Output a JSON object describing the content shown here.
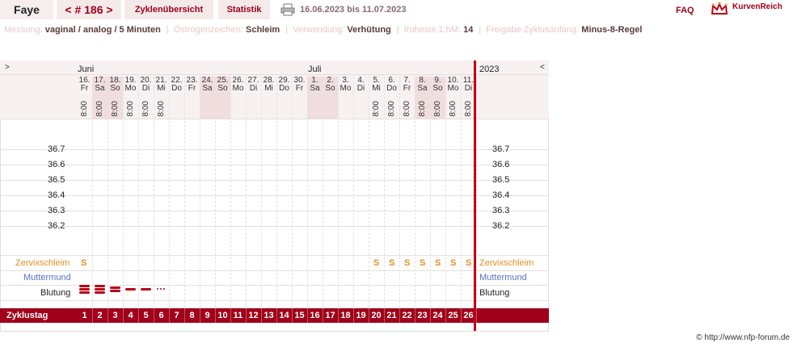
{
  "topbar": {
    "name": "Faye",
    "cycle": "< # 186 >",
    "tab_cycles": "Zyklenübersicht",
    "tab_stats": "Statistik",
    "date_range": "16.06.2023 bis 11.07.2023",
    "faq": "FAQ",
    "brand": "KurvenReich"
  },
  "info": {
    "messung_k": "Messung:",
    "messung_v": "vaginal / analog / 5 Minuten",
    "oestrogen_k": "Östrogenzeichen:",
    "oestrogen_v": "Schleim",
    "verwendung_k": "Verwendung:",
    "verwendung_v": "Verhütung",
    "hm_k": "früheste 1.hM:",
    "hm_v": "14",
    "freigabe_k": "Freigabe Zyklusanfang:",
    "freigabe_v": "Minus-8-Regel"
  },
  "chart": {
    "nav_left": ">",
    "nav_right": "<",
    "month_june": "Juni",
    "month_july": "Juli",
    "year": "2023",
    "temps": [
      "36.7",
      "36.6",
      "36.5",
      "36.4",
      "36.3",
      "36.2"
    ],
    "zervix_label": "Zervixschleim",
    "mutter_label": "Muttermund",
    "blut_label": "Blutung",
    "zyklustag_label": "Zyklustag",
    "days": [
      {
        "d": "16.",
        "w": "Fr",
        "t": "8:00",
        "s": "",
        "we": false
      },
      {
        "d": "17.",
        "w": "Sa",
        "t": "8:00",
        "s": "",
        "we": true
      },
      {
        "d": "18.",
        "w": "So",
        "t": "8:00",
        "s": "",
        "we": true
      },
      {
        "d": "19.",
        "w": "Mo",
        "t": "8:00",
        "s": "",
        "we": false
      },
      {
        "d": "20.",
        "w": "Di",
        "t": "8:00",
        "s": "",
        "we": false
      },
      {
        "d": "21.",
        "w": "Mi",
        "t": "8:00",
        "s": "",
        "we": false
      },
      {
        "d": "22.",
        "w": "Do",
        "t": "",
        "s": "",
        "we": false
      },
      {
        "d": "23.",
        "w": "Fr",
        "t": "",
        "s": "",
        "we": false
      },
      {
        "d": "24.",
        "w": "Sa",
        "t": "",
        "s": "",
        "we": true
      },
      {
        "d": "25.",
        "w": "So",
        "t": "",
        "s": "",
        "we": true
      },
      {
        "d": "26.",
        "w": "Mo",
        "t": "",
        "s": "",
        "we": false
      },
      {
        "d": "27.",
        "w": "Di",
        "t": "",
        "s": "",
        "we": false
      },
      {
        "d": "28.",
        "w": "Mi",
        "t": "",
        "s": "",
        "we": false
      },
      {
        "d": "29.",
        "w": "Do",
        "t": "",
        "s": "",
        "we": false
      },
      {
        "d": "30.",
        "w": "Fr",
        "t": "",
        "s": "",
        "we": false
      },
      {
        "d": "1.",
        "w": "Sa",
        "t": "",
        "s": "",
        "we": true
      },
      {
        "d": "2.",
        "w": "So",
        "t": "",
        "s": "",
        "we": true
      },
      {
        "d": "3.",
        "w": "Mo",
        "t": "",
        "s": "",
        "we": false
      },
      {
        "d": "4.",
        "w": "Di",
        "t": "",
        "s": "",
        "we": false
      },
      {
        "d": "5.",
        "w": "Mi",
        "t": "8:00",
        "s": "S",
        "we": false
      },
      {
        "d": "6.",
        "w": "Do",
        "t": "8:00",
        "s": "S",
        "we": false
      },
      {
        "d": "7.",
        "w": "Fr",
        "t": "8:00",
        "s": "S",
        "we": false
      },
      {
        "d": "8.",
        "w": "Sa",
        "t": "8:00",
        "s": "S",
        "we": true
      },
      {
        "d": "9.",
        "w": "So",
        "t": "8:00",
        "s": "S",
        "we": true
      },
      {
        "d": "10.",
        "w": "Mo",
        "t": "8:00",
        "s": "S",
        "we": false
      },
      {
        "d": "11.",
        "w": "Di",
        "t": "8:00",
        "s": "S",
        "we": false
      }
    ],
    "day1_zervix": "S",
    "bleeding_levels": [
      3,
      3,
      2,
      1,
      1,
      0.5
    ],
    "cycle_days": [
      "1",
      "2",
      "3",
      "4",
      "5",
      "6",
      "7",
      "8",
      "9",
      "10",
      "11",
      "12",
      "13",
      "14",
      "15",
      "16",
      "17",
      "18",
      "19",
      "20",
      "21",
      "22",
      "23",
      "24",
      "25",
      "26"
    ]
  },
  "copyright": "© http://www.nfp-forum.de"
}
